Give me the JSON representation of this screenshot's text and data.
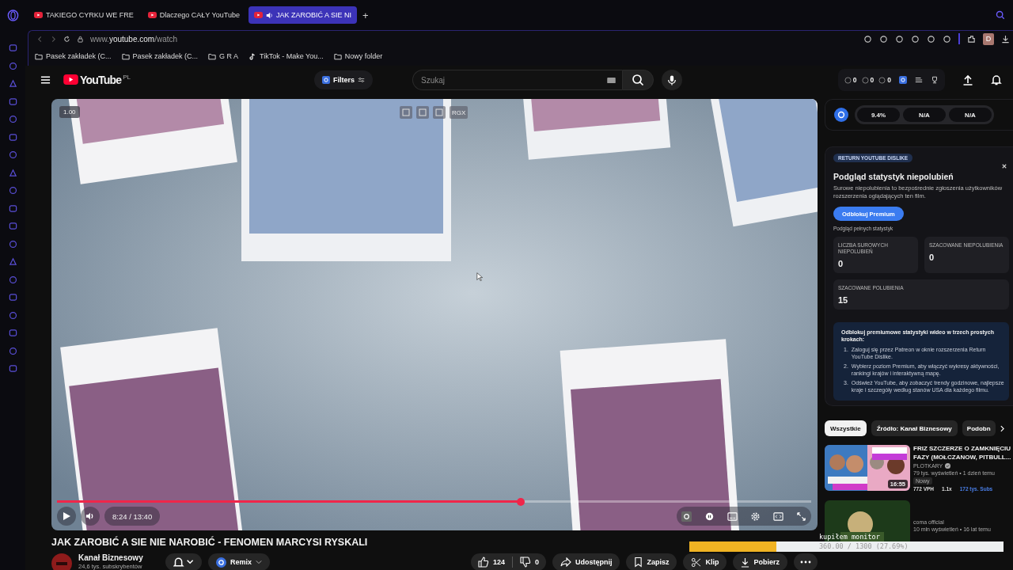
{
  "browser": {
    "tabs": [
      {
        "title": "TAKIEGO CYRKU WE FRE",
        "selected": false,
        "audio": false
      },
      {
        "title": "Dlaczego CAŁY YouTube",
        "selected": false,
        "audio": false
      },
      {
        "title": "JAK ZAROBIĆ A SIE NI",
        "selected": true,
        "audio": true
      }
    ],
    "new_tab": "+",
    "url": {
      "host": "www.youtube.com",
      "path": "/watch"
    },
    "bookmarks": [
      {
        "label": "Pasek zakładek (C...",
        "kind": "folder"
      },
      {
        "label": "Pasek zakładek (C...",
        "kind": "folder"
      },
      {
        "label": "G R A",
        "kind": "folder"
      },
      {
        "label": "TikTok - Make You...",
        "kind": "tiktok"
      },
      {
        "label": "Nowy folder",
        "kind": "folder"
      }
    ],
    "profile_initial": "D"
  },
  "youtube": {
    "logo": "YouTube",
    "region": "PL",
    "filters": "Filters",
    "search_placeholder": "Szukaj",
    "counters": [
      "0",
      "0",
      "0"
    ]
  },
  "player": {
    "speed": "1.00",
    "overlay_label": "RGX",
    "time": "8:24 / 13:40",
    "level": 0.615
  },
  "video": {
    "title": "JAK ZAROBIĆ A SIE NIE NAROBIĆ - FENOMEN MARCYSI RYSKALI",
    "channel": {
      "name": "Kanał Biznesowy",
      "subscribers": "24,6 tys. subskrybentów"
    },
    "remix": "Remix",
    "likes": "124",
    "dislikes": "0",
    "share": "Udostępnij",
    "save": "Zapisz",
    "clip": "Klip",
    "download": "Pobierz"
  },
  "side_panel": {
    "scores": [
      "9.4%",
      "N/A",
      "N/A"
    ],
    "dislike_card": {
      "badge": "RETURN YOUTUBE DISLIKE",
      "title": "Podgląd statystyk niepolubień",
      "text": "Surowe niepolubienia to bezpośrednie zgłoszenia użytkowników rozszerzenia oglądających ten film.",
      "button": "Odblokuj Premium",
      "note": "Podgląd pełnych statystyk",
      "stats": [
        {
          "label": "LICZBA SUROWYCH NIEPOLUBIEŃ",
          "value": "0"
        },
        {
          "label": "SZACOWANE NIEPOLUBIENIA",
          "value": "0"
        },
        {
          "label": "SZACOWANE POLUBIENIA",
          "value": "15"
        }
      ],
      "steps_title": "Odblokuj premiumowe statystyki wideo w trzech prostych krokach:",
      "steps": [
        {
          "number": "1.",
          "text": "Zaloguj się przez Patreon w oknie rozszerzenia Return YouTube Dislike."
        },
        {
          "number": "2.",
          "text": "Wybierz poziom Premium, aby włączyć wykresy aktywności, rankingi krajów i interaktywną mapę."
        },
        {
          "number": "3.",
          "text": "Odśwież YouTube, aby zobaczyć trendy godzinowe, najlepsze kraje i szczegóły według stanów USA dla każdego filmu."
        }
      ]
    },
    "chips": [
      {
        "label": "Wszystkie",
        "selected": true
      },
      {
        "label": "Źródło: Kanał Biznesowy",
        "selected": false
      },
      {
        "label": "Podobn",
        "selected": false
      }
    ],
    "recommendations": [
      {
        "title": "FRIZ SZCZERZE O ZAMKNIĘCIU FAZY (MOŁCZANOW, PITBULL...",
        "channel": "PLOTKARY",
        "meta": "79 tys. wyświetleń • 1 dzień temu",
        "duration": "16:55",
        "badge": "Nowy",
        "vph": "772 VPH",
        "ratio": "1.1x",
        "subs": "172 tys. Subs"
      },
      {
        "channel": "coma official",
        "meta": "10 mln wyświetleń • 16 lat temu"
      }
    ]
  },
  "stream_overlay": {
    "label": "kupiłem monitor",
    "reading": "360.00 / 1300 (27.69%)",
    "level": 0.2769
  }
}
